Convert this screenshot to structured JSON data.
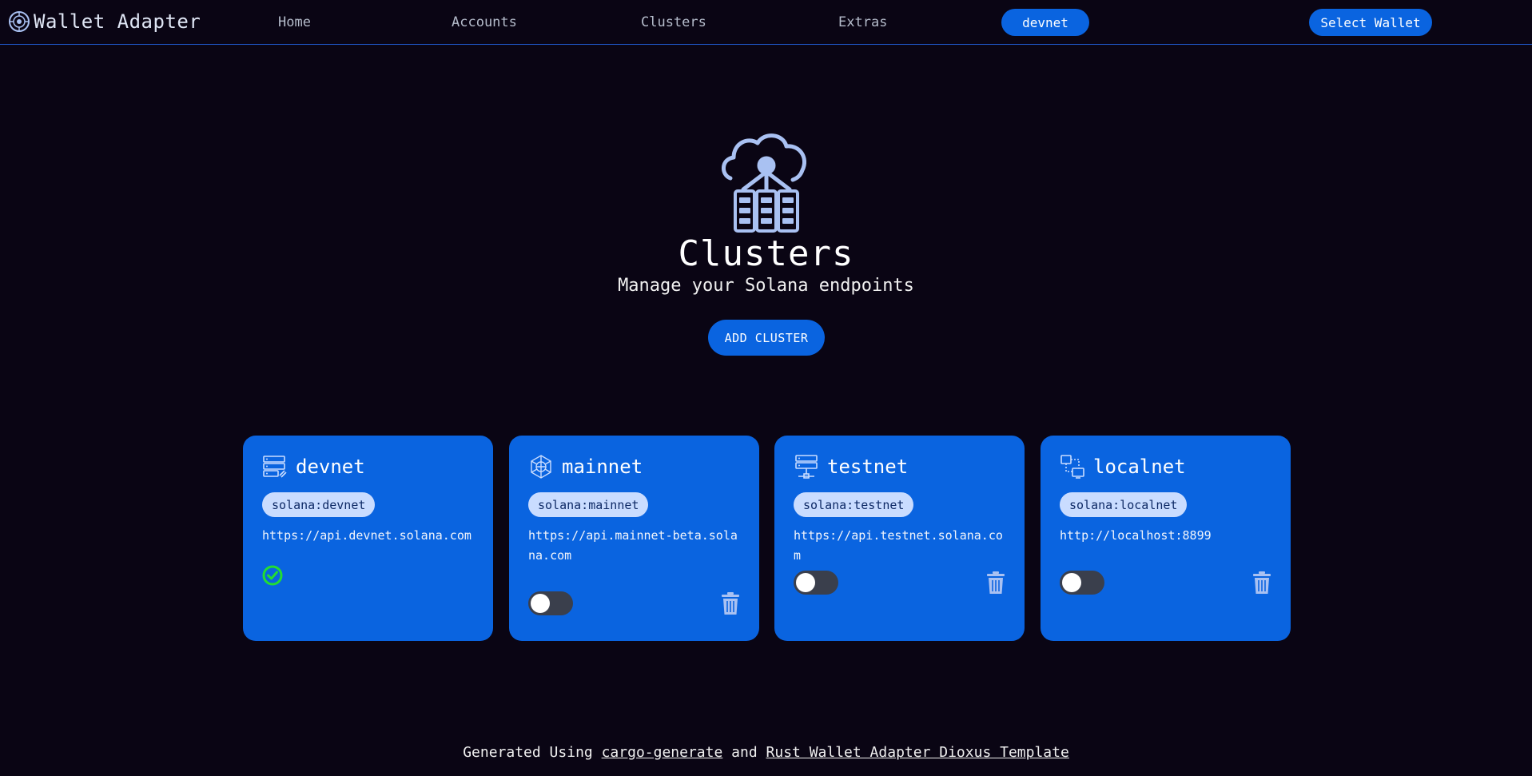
{
  "header": {
    "brand": "Wallet Adapter",
    "nav": [
      "Home",
      "Accounts",
      "Clusters",
      "Extras"
    ],
    "network_button": "devnet",
    "wallet_button": "Select Wallet"
  },
  "hero": {
    "title": "Clusters",
    "subtitle": "Manage your Solana endpoints",
    "add_button": "ADD CLUSTER"
  },
  "clusters": [
    {
      "name": "devnet",
      "chain": "solana:devnet",
      "endpoint": "https://api.devnet.solana.com",
      "active": true
    },
    {
      "name": "mainnet",
      "chain": "solana:mainnet",
      "endpoint": "https://api.mainnet-beta.solana.com",
      "active": false
    },
    {
      "name": "testnet",
      "chain": "solana:testnet",
      "endpoint": "https://api.testnet.solana.com",
      "active": false
    },
    {
      "name": "localnet",
      "chain": "solana:localnet",
      "endpoint": "http://localhost:8899",
      "active": false
    }
  ],
  "footer": {
    "prefix": "Generated Using",
    "link1": "cargo-generate",
    "middle": "and",
    "link2": "Rust Wallet Adapter Dioxus Template"
  },
  "colors": {
    "background": "#0a0514",
    "accent": "#0a64e0",
    "chip": "#c9dcff",
    "icon": "#a9c1f2",
    "success": "#22dd33"
  }
}
